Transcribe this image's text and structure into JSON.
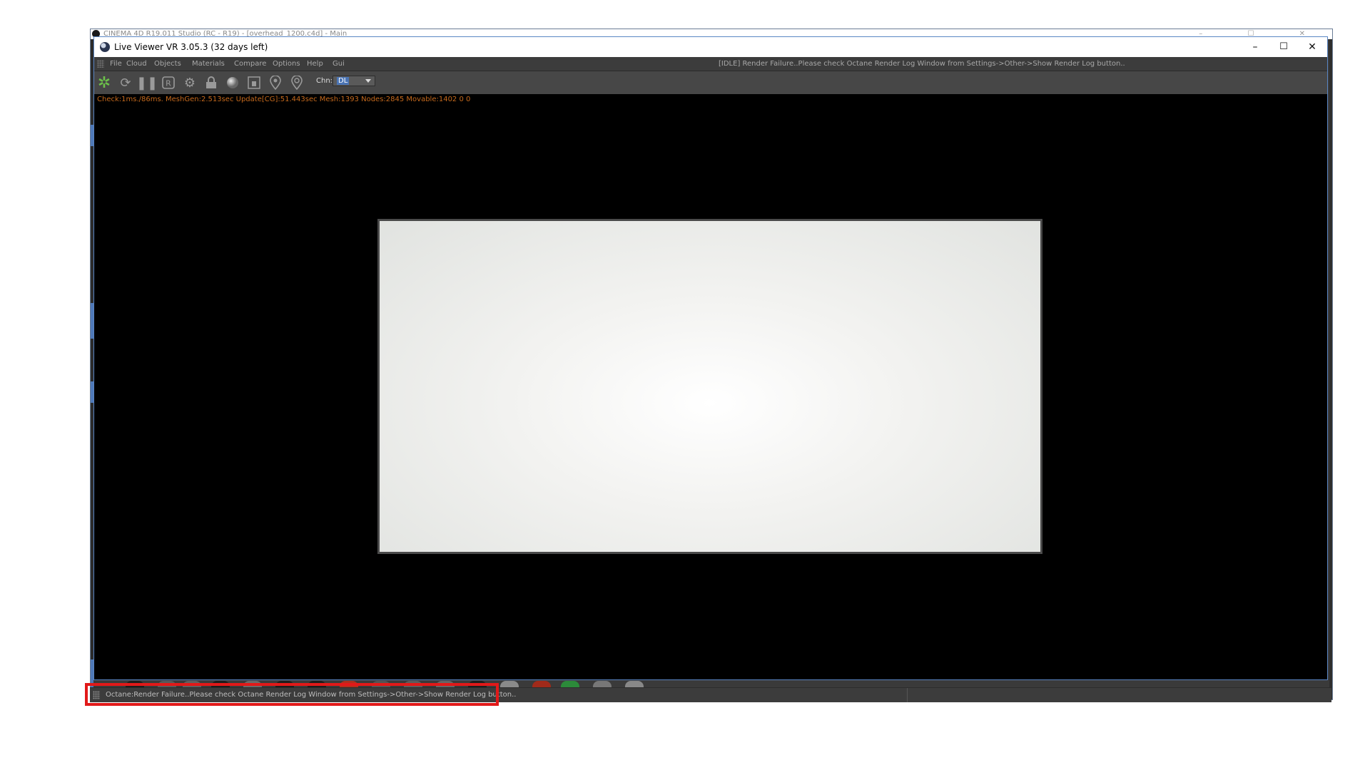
{
  "background_window": {
    "title": "CINEMA 4D R19.011 Studio (RC - R19) - [overhead_1200.c4d] - Main"
  },
  "live_viewer": {
    "title": "Live Viewer VR 3.05.3 (32 days left)",
    "window_controls": {
      "minimize": "–",
      "maximize": "☐",
      "close": "✕"
    },
    "menu": [
      "File",
      "Cloud",
      "Objects",
      "Materials",
      "Compare",
      "Options",
      "Help",
      "Gui"
    ],
    "menu_status": "[IDLE] Render Failure..Please check Octane Render Log Window from Settings->Other->Show Render Log button..",
    "toolbar": {
      "icons": [
        "octane-logo-icon",
        "refresh-icon",
        "pause-icon",
        "region-render-icon",
        "settings-gear-icon",
        "lock-icon",
        "material-ball-icon",
        "clay-mode-icon",
        "pick-focus-icon",
        "pick-material-icon"
      ],
      "channel_label": "Chn:",
      "channel_value": "DL"
    },
    "stats": "Check:1ms./86ms. MeshGen:2.513sec Update[CG]:51.443sec Mesh:1393 Nodes:2845 Movable:1402  0 0"
  },
  "status_bar": {
    "text": "Octane:Render Failure..Please check Octane Render Log Window from Settings->Other->Show Render Log button.."
  },
  "colors": {
    "highlight": "#e11919",
    "stats_text": "#c66a1d",
    "accent": "#4a74b4"
  }
}
